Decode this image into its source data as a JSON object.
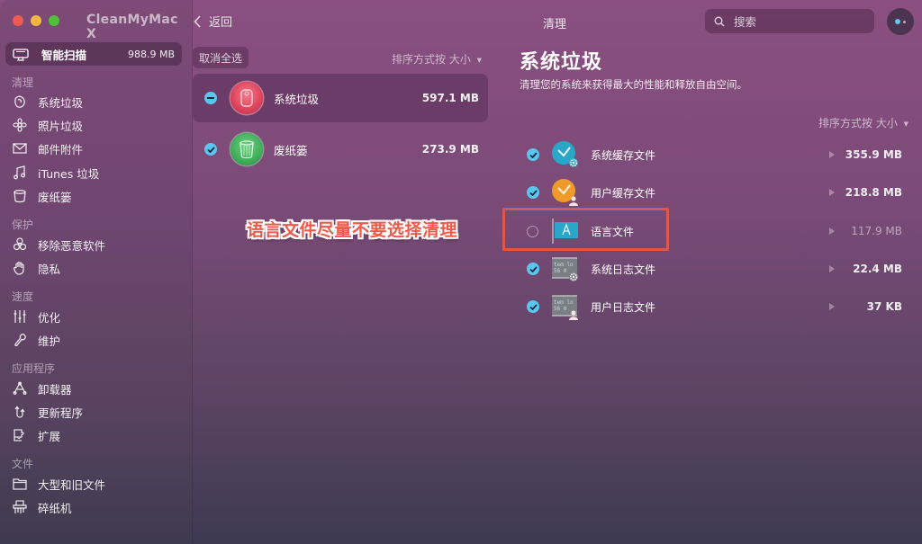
{
  "app": {
    "title": "CleanMyMac X",
    "window_controls": [
      "close",
      "minimize",
      "maximize"
    ]
  },
  "sidebar": {
    "smart_scan": {
      "label": "智能扫描",
      "size": "988.9 MB",
      "icon": "monitor-icon"
    },
    "sections": [
      {
        "header": "清理",
        "items": [
          {
            "label": "系统垃圾",
            "icon": "system-junk-icon"
          },
          {
            "label": "照片垃圾",
            "icon": "flower-icon"
          },
          {
            "label": "邮件附件",
            "icon": "envelope-icon"
          },
          {
            "label": "iTunes 垃圾",
            "icon": "music-note-icon"
          },
          {
            "label": "废纸篓",
            "icon": "trash-bin-icon"
          }
        ]
      },
      {
        "header": "保护",
        "items": [
          {
            "label": "移除恶意软件",
            "icon": "biohazard-icon"
          },
          {
            "label": "隐私",
            "icon": "hand-icon"
          }
        ]
      },
      {
        "header": "速度",
        "items": [
          {
            "label": "优化",
            "icon": "sliders-icon"
          },
          {
            "label": "维护",
            "icon": "wrench-icon"
          }
        ]
      },
      {
        "header": "应用程序",
        "items": [
          {
            "label": "卸载器",
            "icon": "uninstaller-icon"
          },
          {
            "label": "更新程序",
            "icon": "updater-icon"
          },
          {
            "label": "扩展",
            "icon": "puzzle-icon"
          }
        ]
      },
      {
        "header": "文件",
        "items": [
          {
            "label": "大型和旧文件",
            "icon": "folder-icon"
          },
          {
            "label": "碎纸机",
            "icon": "shredder-icon"
          }
        ]
      }
    ]
  },
  "middle": {
    "back_label": "返回",
    "deselect_all": "取消全选",
    "sort_label": "排序方式按 大小",
    "categories": [
      {
        "name": "系统垃圾",
        "size": "597.1 MB",
        "state": "partial",
        "selected": true,
        "icon": "system-junk-icon",
        "color": "#e0465e"
      },
      {
        "name": "废纸篓",
        "size": "273.9 MB",
        "state": "checked",
        "selected": false,
        "icon": "trash-bin-icon",
        "color": "#3fae5a"
      }
    ]
  },
  "header": {
    "section_title": "清理",
    "search_placeholder": "搜索",
    "assistant_icon": "assistant-icon"
  },
  "detail": {
    "title": "系统垃圾",
    "subtitle": "清理您的系统来获得最大的性能和释放自由空间。",
    "sort_label": "排序方式按 大小",
    "items": [
      {
        "name": "系统缓存文件",
        "size": "355.9 MB",
        "checked": true,
        "icon": "system-cache-icon"
      },
      {
        "name": "用户缓存文件",
        "size": "218.8 MB",
        "checked": true,
        "icon": "user-cache-icon"
      },
      {
        "name": "语言文件",
        "size": "117.9 MB",
        "checked": false,
        "icon": "language-flag-icon"
      },
      {
        "name": "系统日志文件",
        "size": "22.4 MB",
        "checked": true,
        "icon": "system-log-icon"
      },
      {
        "name": "用户日志文件",
        "size": "37 KB",
        "checked": true,
        "icon": "user-log-icon"
      }
    ]
  },
  "annotation": {
    "text": "语言文件尽量不要选择清理",
    "color": "#ec5a4c"
  }
}
